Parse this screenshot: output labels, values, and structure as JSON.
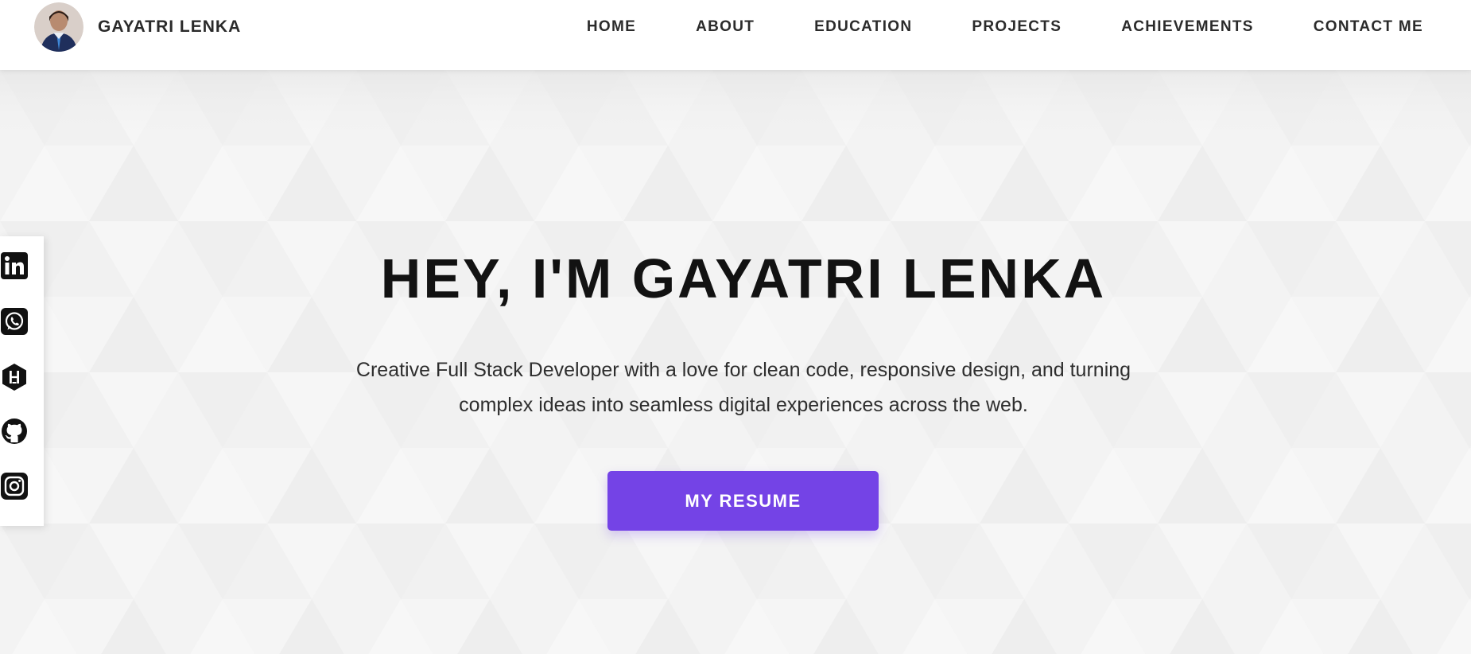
{
  "header": {
    "brand_name": "GAYATRI LENKA",
    "avatar_icon": "profile-photo-avatar",
    "nav": [
      {
        "label": "HOME"
      },
      {
        "label": "ABOUT"
      },
      {
        "label": "EDUCATION"
      },
      {
        "label": "PROJECTS"
      },
      {
        "label": "ACHIEVEMENTS"
      },
      {
        "label": "CONTACT ME"
      }
    ]
  },
  "hero": {
    "title": "HEY, I'M GAYATRI LENKA",
    "subtitle": "Creative Full Stack Developer with a love for clean code, responsive design, and turning complex ideas into seamless digital experiences across the web.",
    "button_label": "MY RESUME"
  },
  "social": [
    {
      "icon": "linkedin-icon"
    },
    {
      "icon": "whatsapp-icon"
    },
    {
      "icon": "hashnode-icon"
    },
    {
      "icon": "github-icon"
    },
    {
      "icon": "instagram-icon"
    }
  ],
  "colors": {
    "accent": "#7443e6",
    "header_bg": "#ffffff",
    "hero_bg": "#f3f3f3",
    "title_text": "#121212",
    "nav_text": "#2b2b2b"
  }
}
